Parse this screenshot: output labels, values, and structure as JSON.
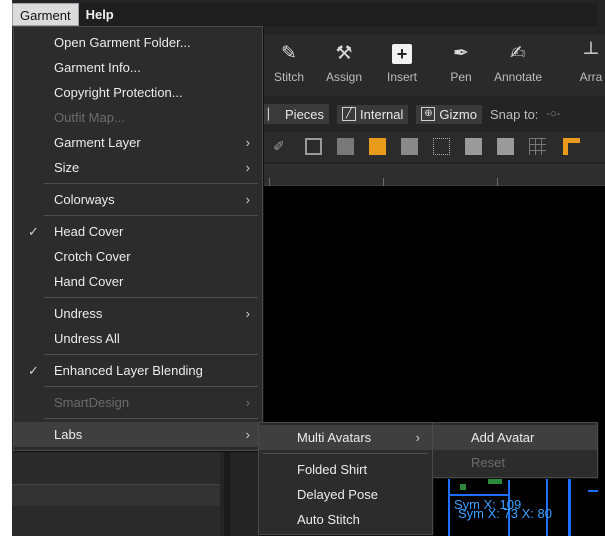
{
  "menubar": {
    "garment": "Garment",
    "help": "Help"
  },
  "toolbar": {
    "tools": [
      {
        "label": "Stitch",
        "icon": "stitch-icon"
      },
      {
        "label": "Assign",
        "icon": "assign-icon"
      },
      {
        "label": "Insert",
        "icon": "insert-icon"
      },
      {
        "label": "Pen",
        "icon": "pen-icon"
      },
      {
        "label": "Annotate",
        "icon": "annotate-icon"
      },
      {
        "label": "Arra",
        "icon": "arrange-icon"
      }
    ],
    "insert_glyph": "+"
  },
  "pieces_bar": {
    "pieces": "Pieces",
    "internal": "Internal",
    "gizmo": "Gizmo",
    "snap_to": "Snap to:",
    "snap_value": "-○-"
  },
  "garment_menu": {
    "open_folder": "Open Garment Folder...",
    "garment_info": "Garment Info...",
    "copyright": "Copyright Protection...",
    "outfit_map": "Outfit Map...",
    "garment_layer": "Garment Layer",
    "size": "Size",
    "colorways": "Colorways",
    "head_cover": "Head Cover",
    "crotch_cover": "Crotch Cover",
    "hand_cover": "Hand Cover",
    "undress": "Undress",
    "undress_all": "Undress All",
    "enhanced_blending": "Enhanced Layer Blending",
    "smart_design": "SmartDesign",
    "labs": "Labs"
  },
  "labs_menu": {
    "multi_avatars": "Multi Avatars",
    "folded_shirt": "Folded Shirt",
    "delayed_pose": "Delayed Pose",
    "auto_stitch": "Auto Stitch"
  },
  "multi_avatars_menu": {
    "add_avatar": "Add Avatar",
    "reset": "Reset"
  },
  "viewport": {
    "sym_label_1": "Sym X: 109",
    "sym_label_2": "Sym X: 73  X: 80"
  },
  "glyphs": {
    "arrow": "›",
    "check": "✓"
  },
  "colors": {
    "accent_orange": "#e89a1a",
    "pattern_blue": "#1e6fff",
    "menu_bg": "#2c2c2c"
  }
}
